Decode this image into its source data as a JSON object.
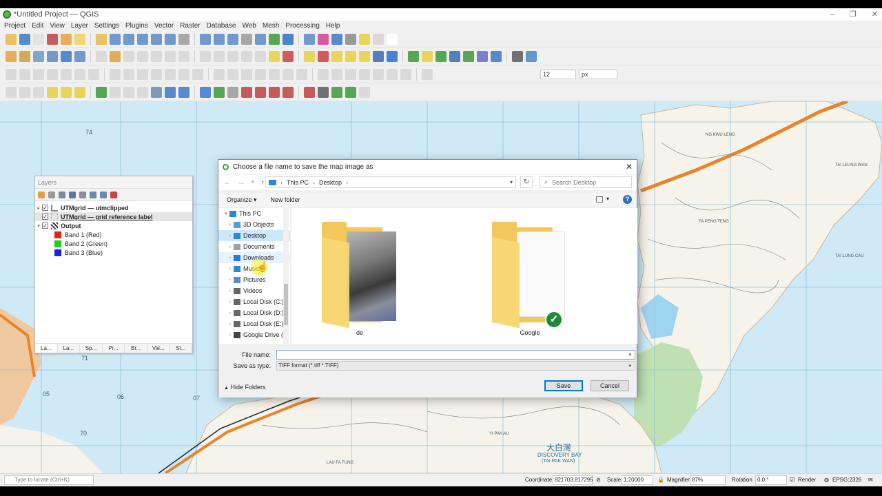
{
  "window": {
    "title": "*Untitled Project — QGIS",
    "controls": [
      "–",
      "❐",
      "✕"
    ]
  },
  "menu": [
    "Project",
    "Edit",
    "View",
    "Layer",
    "Settings",
    "Plugins",
    "Vector",
    "Raster",
    "Database",
    "Web",
    "Mesh",
    "Processing",
    "Help"
  ],
  "toolbar": {
    "font_size": "12",
    "unit": "px"
  },
  "map": {
    "grid_labels": [
      "74",
      "71",
      "70",
      "05",
      "06",
      "07"
    ],
    "place_labels": [
      "NG KWU LENG",
      "FA PENG TENG",
      "DISCOVERY BAY",
      "(TAI PAK WAN)",
      "大白灣",
      "LAU FA FUNG",
      "YI PAK AU",
      "TAI LEUNG WAN",
      "TAI LUNG CAU"
    ]
  },
  "layers_panel": {
    "title": "Layers",
    "layers": [
      {
        "name": "UTMgrid — utmclipped",
        "checked": true,
        "bold": true
      },
      {
        "name": "UTMgrid — grid reference label",
        "checked": true,
        "bold": true,
        "selected": true
      },
      {
        "name": "Output",
        "checked": true,
        "bold": true
      }
    ],
    "bands": [
      {
        "name": "Band 1 (Red)",
        "color": "#e8201a"
      },
      {
        "name": "Band 2 (Green)",
        "color": "#22cc22"
      },
      {
        "name": "Band 3 (Blue)",
        "color": "#1a22e8"
      }
    ],
    "tabs": [
      "La...",
      "La...",
      "Sp...",
      "Pr...",
      "Br...",
      "Val...",
      "St..."
    ]
  },
  "dialog": {
    "title": "Choose a file name to save the map image as",
    "breadcrumb": [
      "This PC",
      "Desktop"
    ],
    "search_placeholder": "Search Desktop",
    "organize": "Organize ▾",
    "new_folder": "New folder",
    "nav": [
      {
        "label": "This PC",
        "icon": "pc-icon",
        "color": "#2b88d8"
      },
      {
        "label": "3D Objects",
        "icon": "3d-objects-icon",
        "color": "#4aa0e0"
      },
      {
        "label": "Desktop",
        "icon": "desktop-icon",
        "color": "#2b88d8"
      },
      {
        "label": "Documents",
        "icon": "documents-icon",
        "color": "#9aa0a6"
      },
      {
        "label": "Downloads",
        "icon": "downloads-icon",
        "color": "#2b78d8"
      },
      {
        "label": "Music",
        "icon": "music-icon",
        "color": "#2b88d8"
      },
      {
        "label": "Pictures",
        "icon": "pictures-icon",
        "color": "#5a8ac8"
      },
      {
        "label": "Videos",
        "icon": "videos-icon",
        "color": "#666"
      },
      {
        "label": "Local Disk (C:)",
        "icon": "disk-icon",
        "color": "#666"
      },
      {
        "label": "Local Disk (D:)",
        "icon": "disk-icon",
        "color": "#666"
      },
      {
        "label": "Local Disk (E:)",
        "icon": "disk-icon",
        "color": "#666"
      },
      {
        "label": "Google Drive (",
        "icon": "google-drive-icon",
        "color": "#444"
      }
    ],
    "files": [
      {
        "name": "de"
      },
      {
        "name": "Google"
      }
    ],
    "file_name_label": "File name:",
    "file_name_value": "",
    "save_type_label": "Save as type:",
    "save_type_value": "TIFF format (*.tiff *.TIFF)",
    "hide_folders": "Hide Folders",
    "save": "Save",
    "cancel": "Cancel"
  },
  "statusbar": {
    "locate_placeholder": "Type to locate (Ctrl+K)",
    "coordinate_label": "Coordinate",
    "coordinate": "821703,817295",
    "scale_label": "Scale",
    "scale": "1:20000",
    "magnifier_label": "Magnifier",
    "magnifier": "87%",
    "rotation_label": "Rotation",
    "rotation": "0.0 °",
    "render_label": "Render",
    "crs": "EPSG:2326"
  }
}
